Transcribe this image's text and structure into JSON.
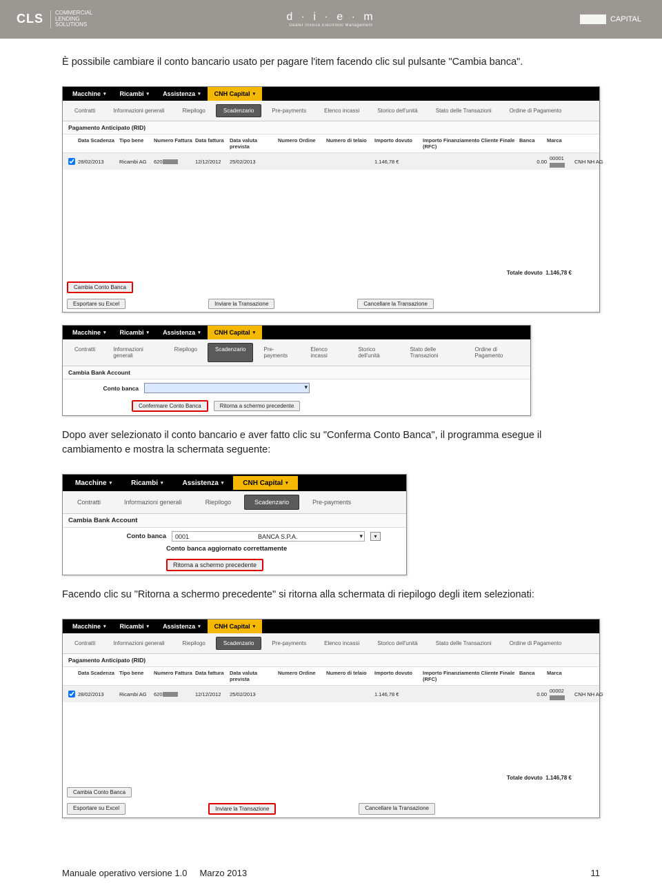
{
  "header": {
    "cls_label": "CLS",
    "cls_sub1": "COMMERCIAL",
    "cls_sub2": "LENDING",
    "cls_sub3": "SOLUTIONS",
    "diem_label": "d · i · e · m",
    "diem_sub": "Dealer Invoice Electronic Management",
    "capital_label": "CAPITAL"
  },
  "body": {
    "para1": "È possibile cambiare il conto bancario usato per pagare l'item facendo clic sul pulsante \"Cambia banca\".",
    "para2": "Dopo aver selezionato il conto bancario e aver fatto clic su \"Conferma Conto Banca\", il programma esegue il cambiamento e mostra la schermata seguente:",
    "para3": "Facendo clic su \"Ritorna a schermo precedente\" si ritorna alla schermata di riepilogo degli item selezionati:"
  },
  "nav": {
    "macchine": "Macchine",
    "ricambi": "Ricambi",
    "assistenza": "Assistenza",
    "cnh": "CNH Capital"
  },
  "subnav": {
    "contratti": "Contratti",
    "info": "Informazioni generali",
    "riepilogo": "Riepilogo",
    "scadenzario": "Scadenzario",
    "prepay": "Pre-payments",
    "elenco": "Elenco incassi",
    "storico": "Storico dell'unità",
    "stato": "Stato delle Transazioni",
    "ordine": "Ordine di Pagamento"
  },
  "table": {
    "section_label": "Pagamento Anticipato (RID)",
    "headers": {
      "h1": "Data Scadenza",
      "h2": "Tipo bene",
      "h3": "Numero Fattura",
      "h4": "Data fattura",
      "h5": "Data valuta prevista",
      "h6": "Numero Ordine",
      "h7": "Numero di telaio",
      "h8": "Importo dovuto",
      "h9": "Importo Finanziamento Cliente Finale (RFC)",
      "h10": "Banca",
      "h11": "Marca"
    },
    "row": {
      "date": "28/02/2013",
      "tipo": "Ricambi AG",
      "fatt_prefix": "620",
      "dfatt": "12/12/2012",
      "dval": "25/02/2013",
      "importo": "1.146,78 €",
      "rfc": "0.00",
      "banca_prefix": "00001",
      "marca": "CNH NH AG"
    },
    "row4_banca_prefix": "00002",
    "total_label": "Totale dovuto",
    "total_value": "1.146,78  €"
  },
  "buttons": {
    "cambia_conto": "Cambia Conto Banca",
    "esporta": "Esportare su Excel",
    "inviare": "Inviare la Transazione",
    "cancellare": "Cancellare la Transazione",
    "confermare": "Confermare Conto Banca",
    "ritorna": "Ritorna a schermo precedente"
  },
  "form": {
    "cambia_bank_label": "Cambia Bank Account",
    "conto_banca_label": "Conto banca",
    "select_code": "0001",
    "select_name": "BANCA S.P.A.",
    "confirm_msg": "Conto banca aggiornato correttamente"
  },
  "footer": {
    "manual": "Manuale operativo versione 1.0",
    "date": "Marzo 2013",
    "page": "11"
  }
}
